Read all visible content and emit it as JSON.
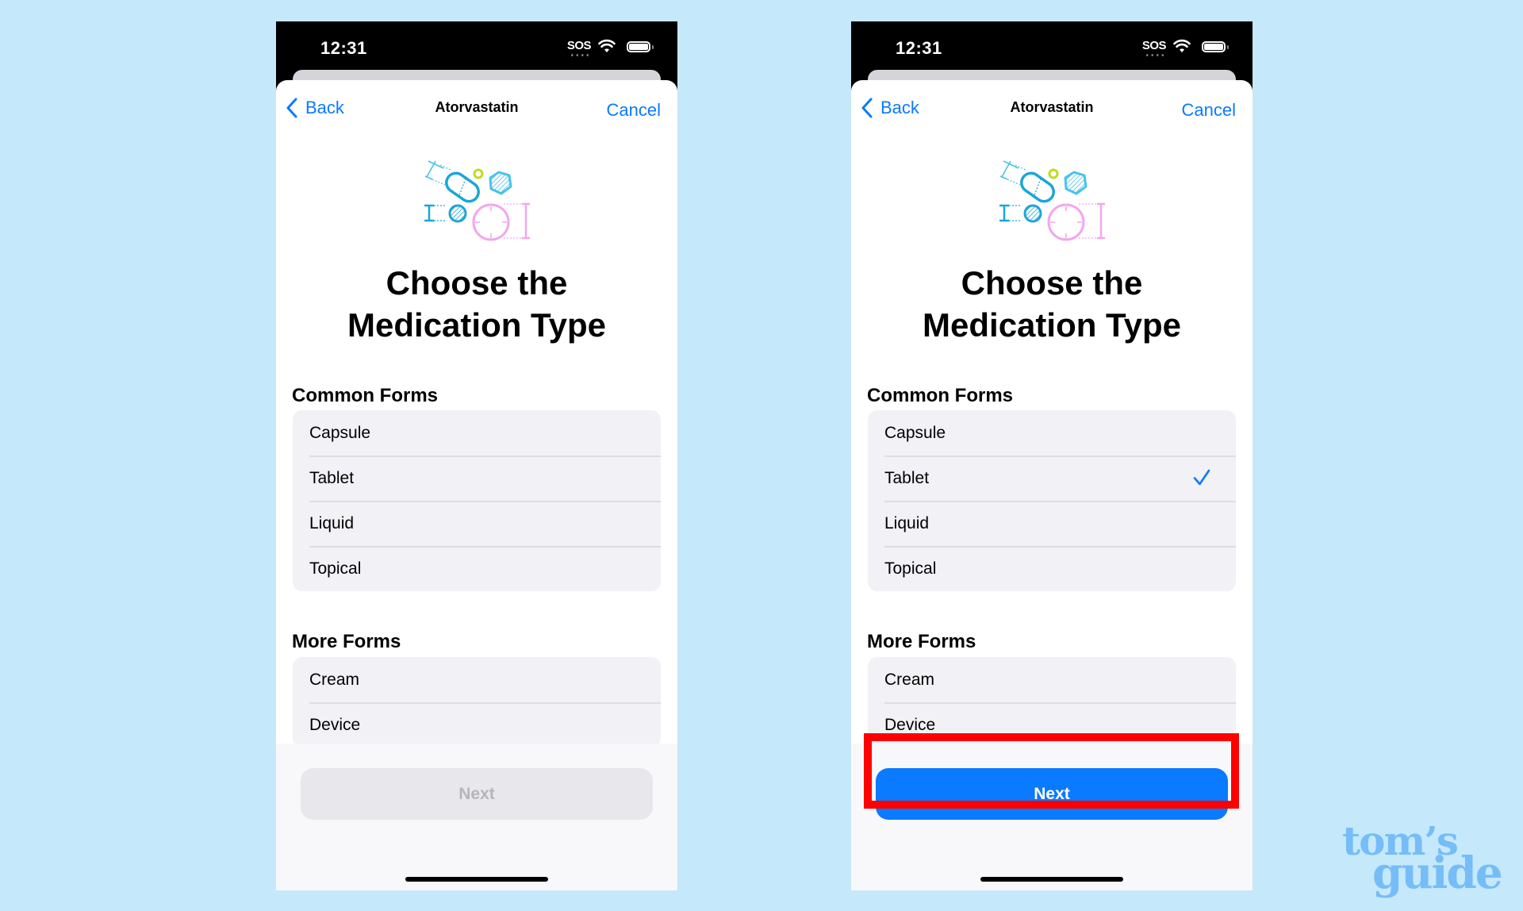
{
  "colors": {
    "background": "#c5e8fb",
    "accent": "#0a7aff",
    "highlight": "#fe0000",
    "watermark": "#76bdf7"
  },
  "phones": [
    {
      "status": {
        "time": "12:31",
        "carrier": "SOS"
      },
      "nav": {
        "back_label": "Back",
        "title": "Atorvastatin",
        "cancel_label": "Cancel"
      },
      "heading_line1": "Choose the",
      "heading_line2": "Medication Type",
      "common_forms": {
        "label": "Common Forms",
        "items": [
          {
            "label": "Capsule",
            "selected": false
          },
          {
            "label": "Tablet",
            "selected": false
          },
          {
            "label": "Liquid",
            "selected": false
          },
          {
            "label": "Topical",
            "selected": false
          }
        ]
      },
      "more_forms": {
        "label": "More Forms",
        "items": [
          {
            "label": "Cream"
          },
          {
            "label": "Device"
          }
        ]
      },
      "next": {
        "label": "Next",
        "enabled": false
      }
    },
    {
      "status": {
        "time": "12:31",
        "carrier": "SOS"
      },
      "nav": {
        "back_label": "Back",
        "title": "Atorvastatin",
        "cancel_label": "Cancel"
      },
      "heading_line1": "Choose the",
      "heading_line2": "Medication Type",
      "common_forms": {
        "label": "Common Forms",
        "items": [
          {
            "label": "Capsule",
            "selected": false
          },
          {
            "label": "Tablet",
            "selected": true
          },
          {
            "label": "Liquid",
            "selected": false
          },
          {
            "label": "Topical",
            "selected": false
          }
        ]
      },
      "more_forms": {
        "label": "More Forms",
        "items": [
          {
            "label": "Cream"
          },
          {
            "label": "Device"
          }
        ]
      },
      "next": {
        "label": "Next",
        "enabled": true
      }
    }
  ],
  "watermark": {
    "line1": "tom’s",
    "line2": "guide"
  }
}
